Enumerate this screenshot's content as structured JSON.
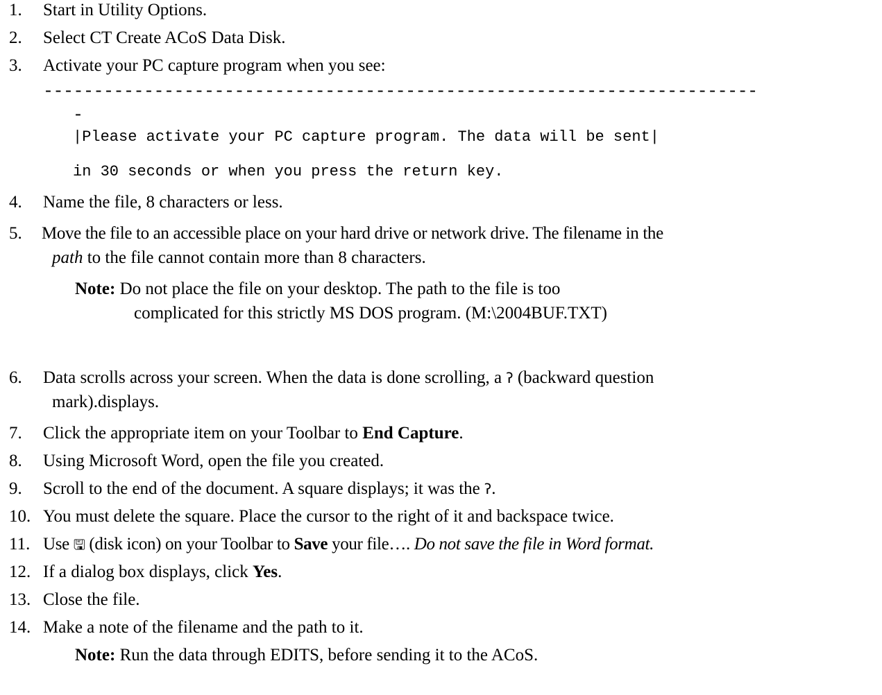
{
  "steps": {
    "s1": {
      "num": "1.",
      "text": "Start in Utility Options."
    },
    "s2": {
      "num": "2.",
      "text": "Select CT  Create ACoS Data Disk."
    },
    "s3": {
      "num": "3.",
      "text": "Activate your PC capture program when you see:"
    },
    "s4": {
      "num": "4.",
      "text": "Name the file, 8 characters or less."
    },
    "s5": {
      "num": "5.",
      "line1": "Move the file to an accessible place on your hard drive or network drive. The filename in the",
      "line2_em": "path",
      "line2_rest": " to the file cannot contain more than 8 characters."
    },
    "s6": {
      "num": "6.",
      "line1_a": "Data scrolls across your screen. When the data is done scrolling, a ",
      "glyph": "ʔ",
      "line1_b": " (backward question",
      "line2": "mark).displays."
    },
    "s7": {
      "num": "7.",
      "pre": "Click the appropriate item on your Toolbar to ",
      "bold": "End Capture",
      "post": "."
    },
    "s8": {
      "num": "8.",
      "text": "Using Microsoft Word, open the file you created."
    },
    "s9": {
      "num": "9.",
      "pre": "Scroll to the end of the document. A square displays; it was the ",
      "glyph": "ʔ",
      "post": "."
    },
    "s10": {
      "num": "10.",
      "text": "You must delete the square. Place the cursor to the right of it and backspace twice."
    },
    "s11": {
      "num": "11.",
      "pre": "Use ",
      "glyph": "🖫",
      "mid": " (disk icon) on your Toolbar to ",
      "bold": "Save",
      "mid2": " your file…. ",
      "em": "Do not save the file in Word format."
    },
    "s12": {
      "num": "12.",
      "pre": "If a dialog box displays, click ",
      "bold": "Yes",
      "post": "."
    },
    "s13": {
      "num": "13.",
      "text": "Close the file."
    },
    "s14": {
      "num": "14.",
      "text": "Make a note of the filename and the path to it."
    }
  },
  "terminal": {
    "dashes": "-----------------------------------------------------------------------",
    "dash2": "-",
    "line1": "|Please activate your PC capture program.  The data will be sent|",
    "line2": "in 30 seconds or when you press the return key."
  },
  "note1": {
    "label": "Note:",
    "line1": " Do not place the file on your desktop. The path to the file is too",
    "line2": "complicated for this strictly MS DOS program. (M:\\2004BUF.TXT)"
  },
  "note2": {
    "label": "Note:",
    "text": " Run the data through EDITS, before sending it to the ACoS."
  }
}
